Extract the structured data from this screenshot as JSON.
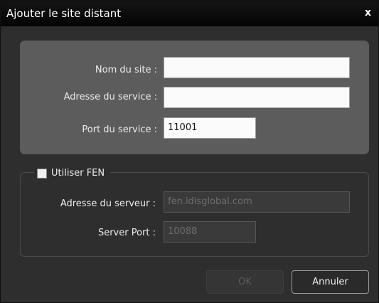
{
  "window": {
    "title": "Ajouter le site distant",
    "close_glyph": "x"
  },
  "site": {
    "name_label": "Nom du site :",
    "name_value": "",
    "address_label": "Adresse du service :",
    "address_value": "",
    "port_label": "Port du service :",
    "port_value": "11001"
  },
  "fen": {
    "checkbox_label": "Utiliser FEN",
    "checked": false,
    "server_address_label": "Adresse du serveur :",
    "server_address_value": "fen.idisglobal.com",
    "server_port_label": "Server Port :",
    "server_port_value": "10088"
  },
  "buttons": {
    "ok": "OK",
    "cancel": "Annuler"
  }
}
